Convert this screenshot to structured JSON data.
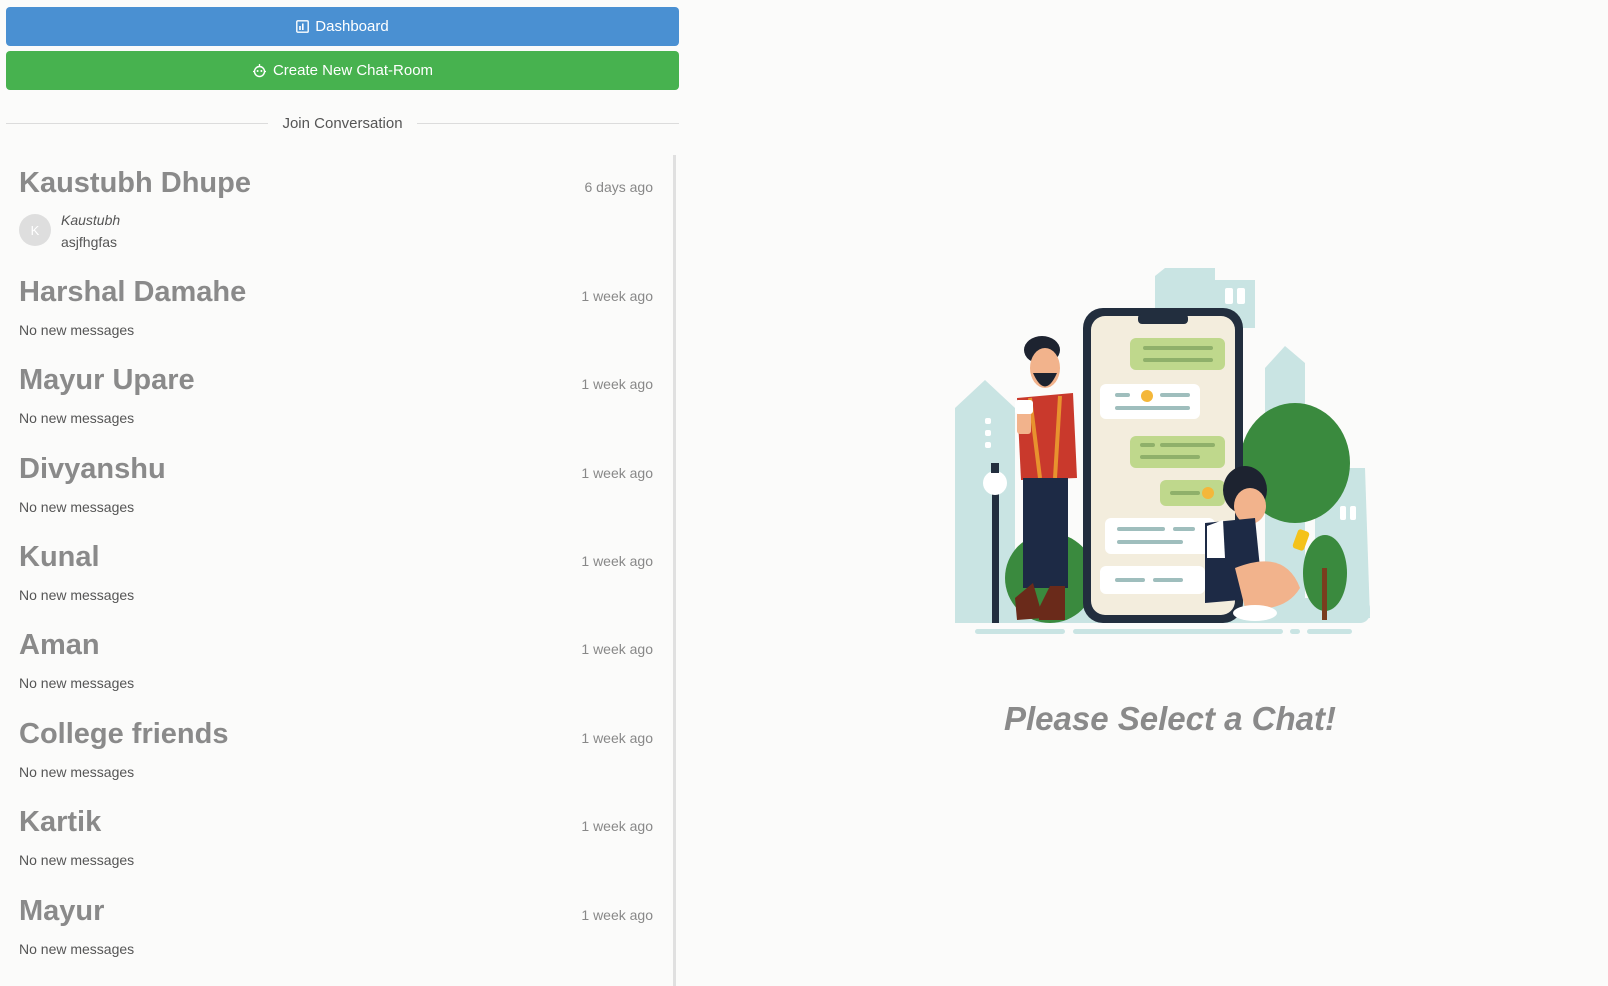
{
  "sidebar": {
    "dashboard_button": {
      "label": "Dashboard",
      "icon": "chart-icon",
      "color": "#4a90d2"
    },
    "create_button": {
      "label": "Create New Chat-Room",
      "icon": "robot-icon",
      "color": "#47b24f"
    },
    "divider_label": "Join Conversation",
    "chats": [
      {
        "name": "Kaustubh Dhupe",
        "time": "6 days ago",
        "avatar_letter": "K",
        "last_sender": "Kaustubh",
        "last_message": "asjfhgfas"
      },
      {
        "name": "Harshal Damahe",
        "time": "1 week ago",
        "status": "No new messages"
      },
      {
        "name": "Mayur Upare",
        "time": "1 week ago",
        "status": "No new messages"
      },
      {
        "name": "Divyanshu",
        "time": "1 week ago",
        "status": "No new messages"
      },
      {
        "name": "Kunal",
        "time": "1 week ago",
        "status": "No new messages"
      },
      {
        "name": "Aman",
        "time": "1 week ago",
        "status": "No new messages"
      },
      {
        "name": "College friends",
        "time": "1 week ago",
        "status": "No new messages"
      },
      {
        "name": "Kartik",
        "time": "1 week ago",
        "status": "No new messages"
      },
      {
        "name": "Mayur",
        "time": "1 week ago",
        "status": "No new messages"
      }
    ]
  },
  "main": {
    "empty_state_message": "Please Select a Chat!"
  }
}
